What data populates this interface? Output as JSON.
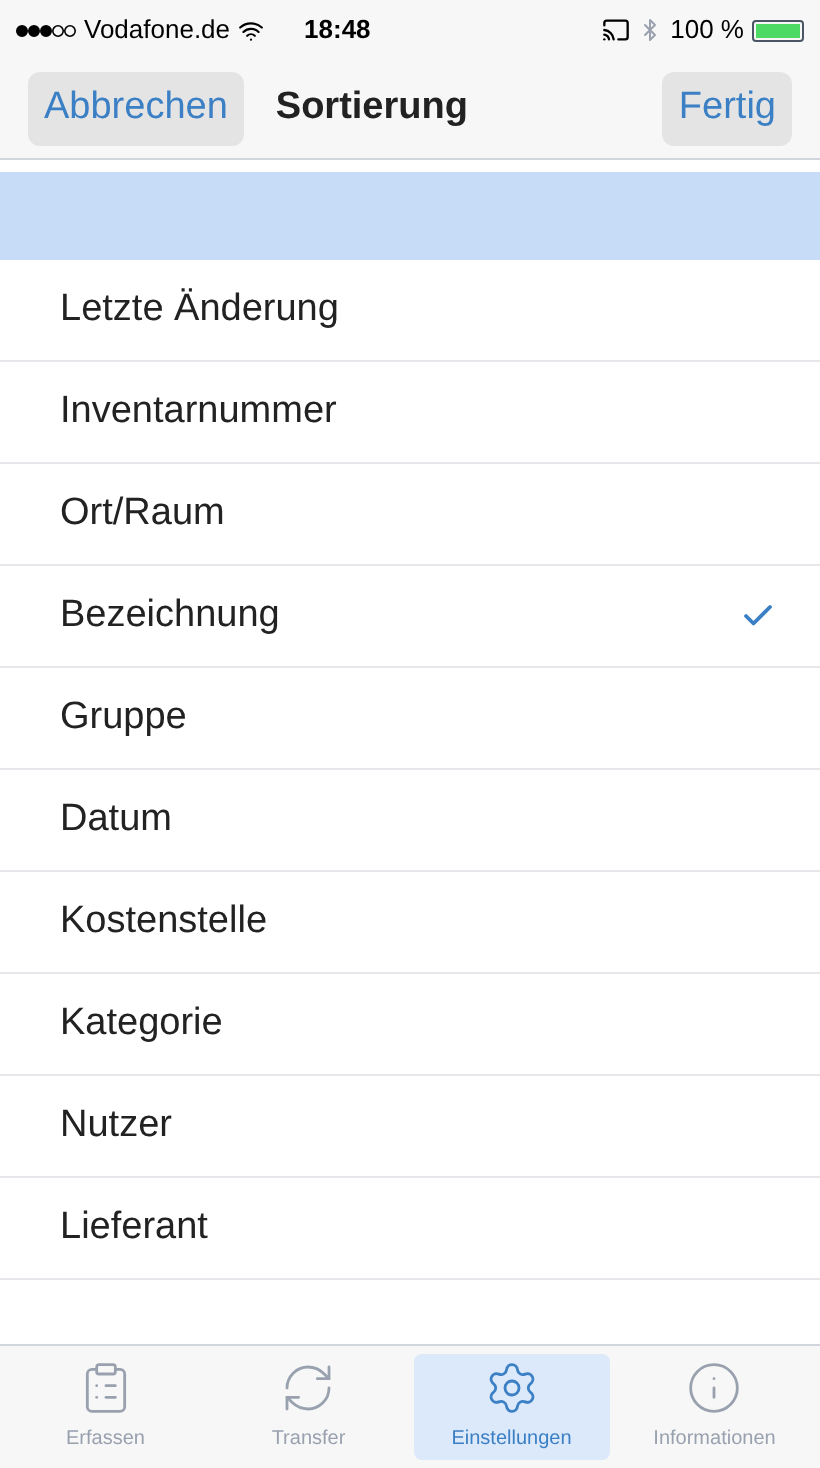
{
  "status_bar": {
    "carrier": "Vodafone.de",
    "time": "18:48",
    "battery": "100 %"
  },
  "nav": {
    "cancel": "Abbrechen",
    "title": "Sortierung",
    "done": "Fertig"
  },
  "options": [
    {
      "label": "Letzte Änderung",
      "selected": false
    },
    {
      "label": "Inventarnummer",
      "selected": false
    },
    {
      "label": "Ort/Raum",
      "selected": false
    },
    {
      "label": "Bezeichnung",
      "selected": true
    },
    {
      "label": "Gruppe",
      "selected": false
    },
    {
      "label": "Datum",
      "selected": false
    },
    {
      "label": "Kostenstelle",
      "selected": false
    },
    {
      "label": "Kategorie",
      "selected": false
    },
    {
      "label": "Nutzer",
      "selected": false
    },
    {
      "label": "Lieferant",
      "selected": false
    }
  ],
  "tab_bar": [
    {
      "kind": "clipboard",
      "label": "Erfassen",
      "selected": false
    },
    {
      "kind": "sync",
      "label": "Transfer",
      "selected": false
    },
    {
      "kind": "gear",
      "label": "Einstellungen",
      "selected": true
    },
    {
      "kind": "info",
      "label": "Informationen",
      "selected": false
    }
  ]
}
